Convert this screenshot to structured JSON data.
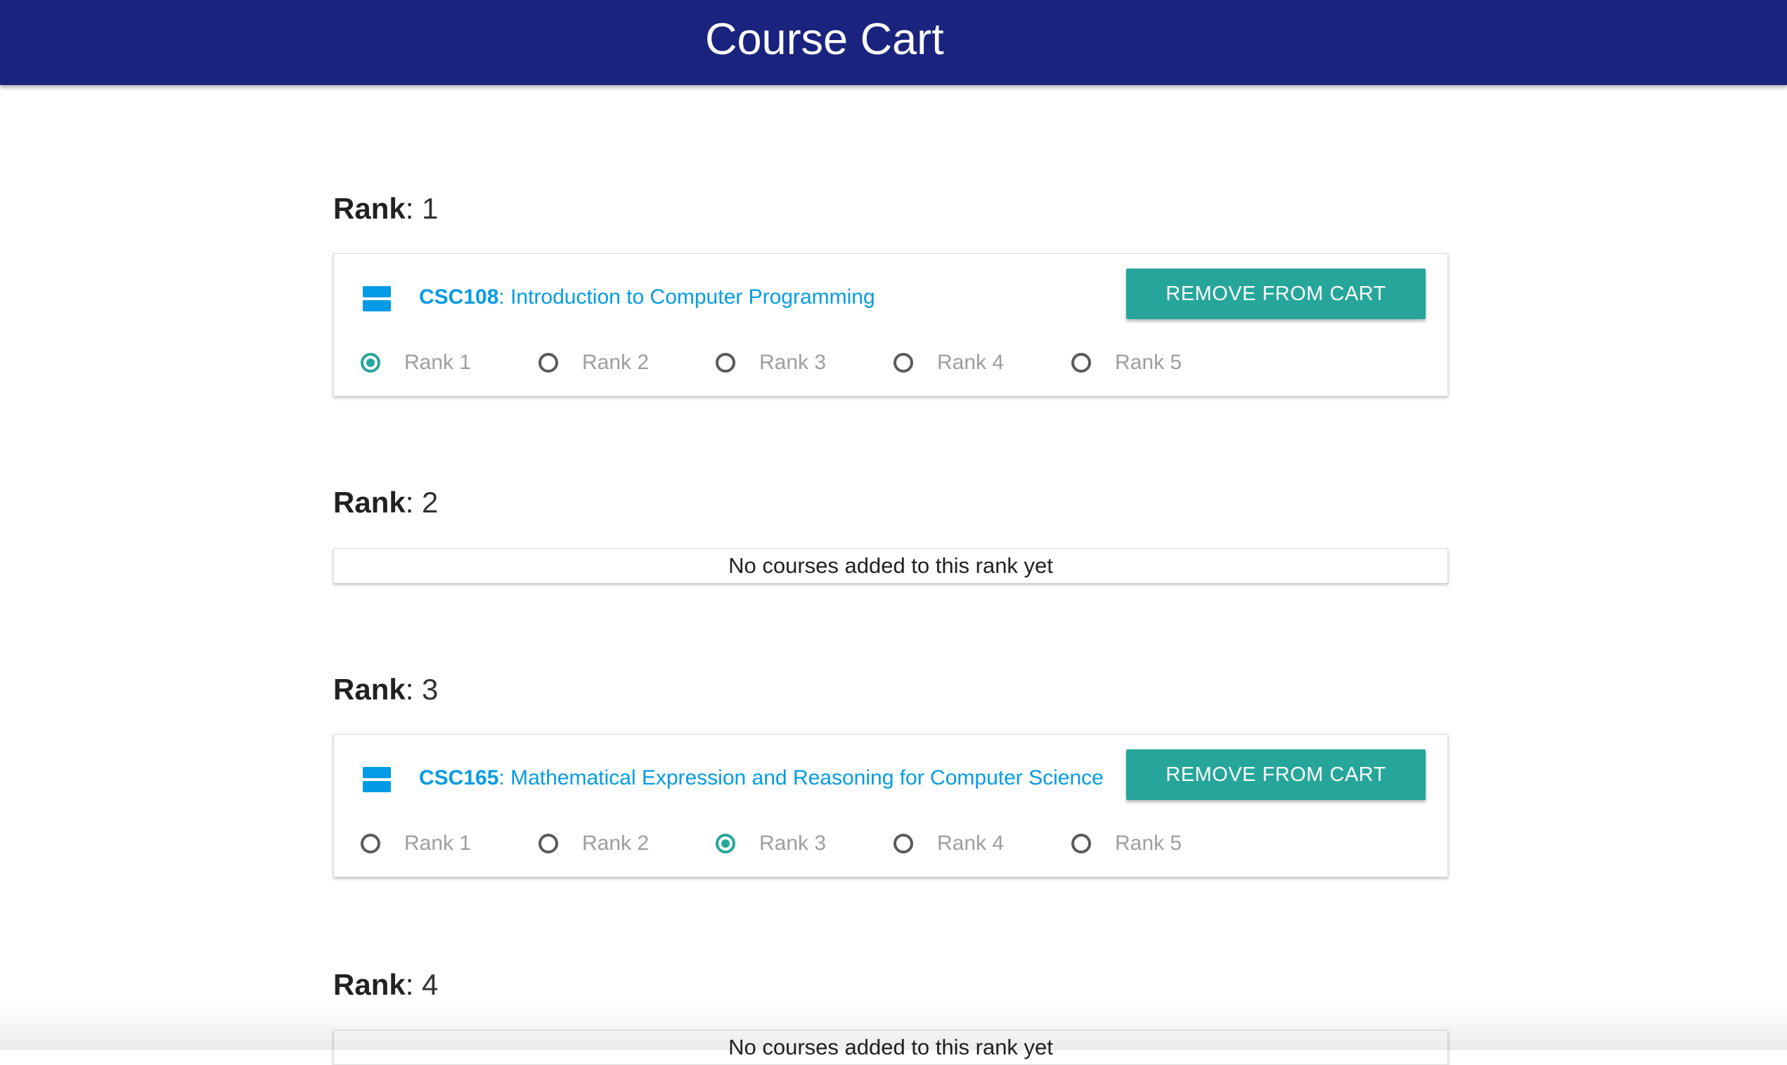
{
  "header": {
    "title": "Course Cart"
  },
  "ranks": [
    {
      "label": "Rank",
      "sep": ": ",
      "number": "1",
      "course": {
        "code": "CSC108",
        "title": ": Introduction to Computer Programming",
        "remove_label": "REMOVE FROM CART",
        "options": [
          "Rank 1",
          "Rank 2",
          "Rank 3",
          "Rank 4",
          "Rank 5"
        ],
        "selected_option": "Rank 1"
      }
    },
    {
      "label": "Rank",
      "sep": ": ",
      "number": "2",
      "empty_text": "No courses added to this rank yet"
    },
    {
      "label": "Rank",
      "sep": ": ",
      "number": "3",
      "course": {
        "code": "CSC165",
        "title": ": Mathematical Expression and Reasoning for Computer Science",
        "remove_label": "REMOVE FROM CART",
        "options": [
          "Rank 1",
          "Rank 2",
          "Rank 3",
          "Rank 4",
          "Rank 5"
        ],
        "selected_option": "Rank 3"
      }
    },
    {
      "label": "Rank",
      "sep": ": ",
      "number": "4",
      "empty_text": "No courses added to this rank yet"
    }
  ],
  "colors": {
    "app_bar": "#1a237e",
    "accent": "#26a69a",
    "link": "#039be5"
  },
  "icons": {
    "course": "view-agenda-icon"
  }
}
